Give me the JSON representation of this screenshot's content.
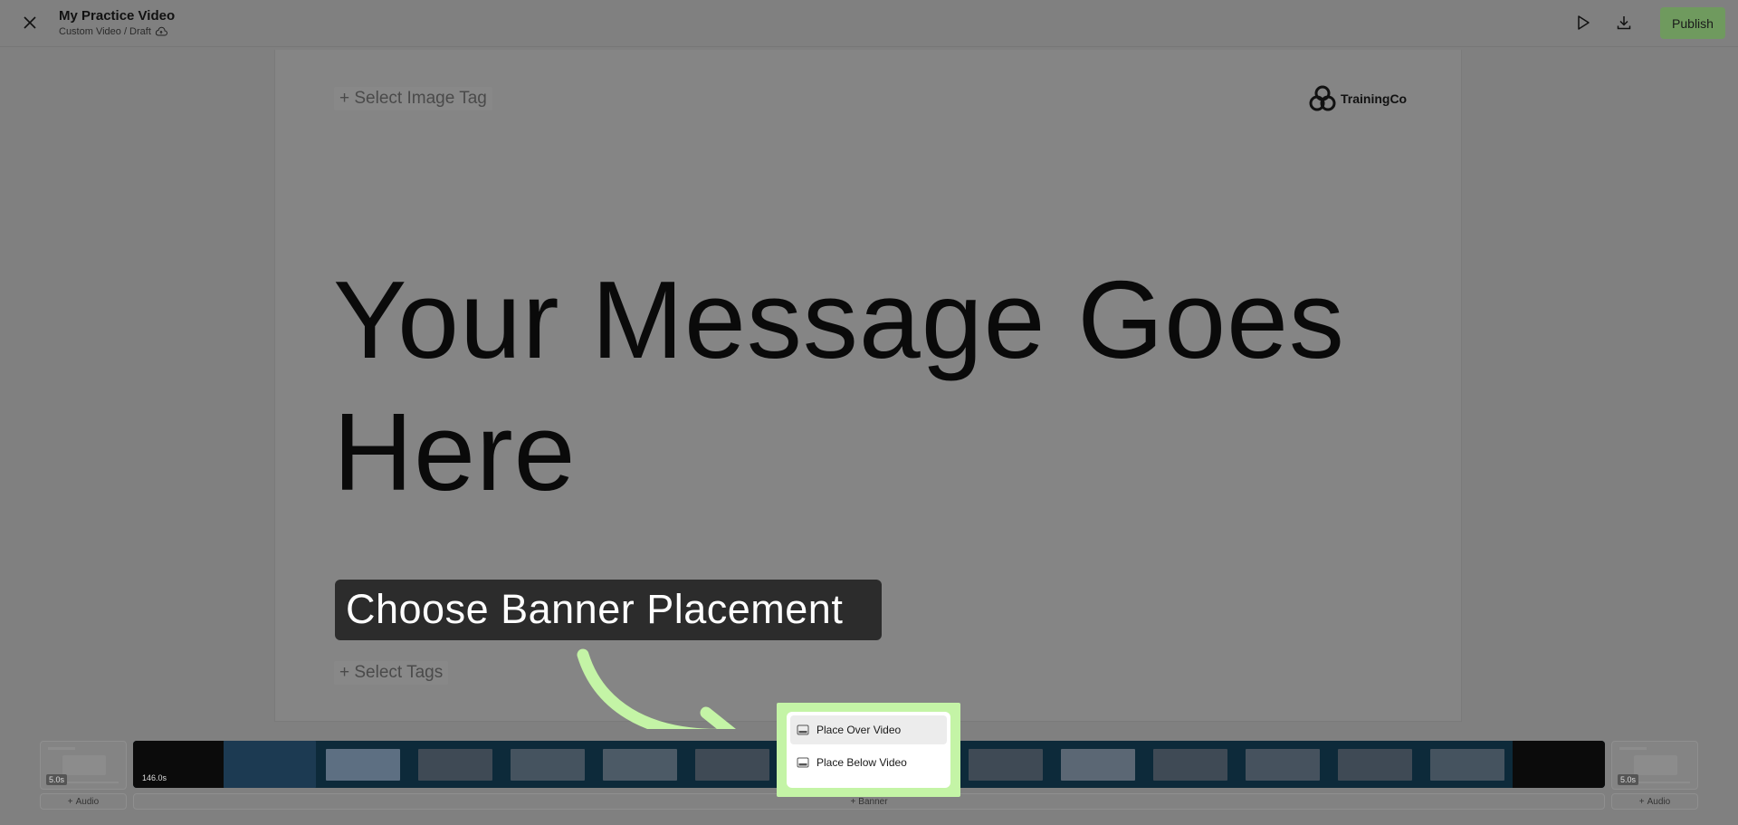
{
  "header": {
    "title": "My Practice Video",
    "subtitle": "Custom Video / Draft",
    "publish_label": "Publish",
    "colors": {
      "publish_bg": "#6f9a5e",
      "overlay": "#808080"
    }
  },
  "canvas": {
    "image_tag_label": "+ Select Image Tag",
    "logo_text": "TrainingCo",
    "headline": "Your Message Goes Here",
    "tags_label": "+ Select Tags"
  },
  "callout": {
    "text": "Choose Banner Placement",
    "highlight_color": "#c4f4a6"
  },
  "popup": {
    "items": [
      {
        "label": "Place Over Video",
        "icon": "banner-icon"
      },
      {
        "label": "Place Below Video",
        "icon": "banner-icon"
      }
    ]
  },
  "timeline": {
    "left_slot_duration": "5.0s",
    "main_duration": "146.0s",
    "right_slot_duration": "5.0s",
    "add_audio_left": "Audio",
    "add_banner": "Banner",
    "add_audio_right": "Audio"
  }
}
